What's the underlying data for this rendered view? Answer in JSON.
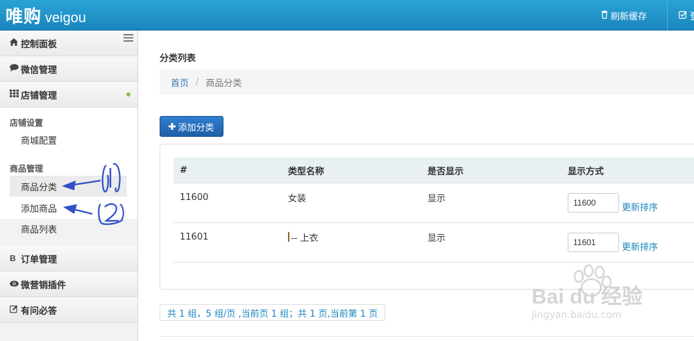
{
  "header": {
    "logo_cn": "唯购",
    "logo_en": "veigou",
    "refresh_label": "刷新缓存",
    "other_label": "登"
  },
  "sidebar": {
    "menus": [
      {
        "label": "控制面板",
        "icon": "home-icon"
      },
      {
        "label": "微信管理",
        "icon": "comment-icon"
      },
      {
        "label": "店铺管理",
        "icon": "grid-icon"
      },
      {
        "label": "订单管理",
        "icon": "bitcoin-icon"
      },
      {
        "label": "微营销插件",
        "icon": "eye-icon"
      },
      {
        "label": "有问必答",
        "icon": "edit-icon"
      }
    ],
    "sections": [
      {
        "title": "店铺设置",
        "items": [
          "商城配置"
        ]
      },
      {
        "title": "商品管理",
        "items": [
          "商品分类",
          "添加商品",
          "商品列表"
        ]
      }
    ],
    "active_item": "商品分类"
  },
  "main": {
    "page_title": "分类列表",
    "breadcrumb": {
      "home": "首页",
      "sep": "/",
      "current": "商品分类"
    },
    "add_button": "添加分类",
    "table": {
      "headers": [
        "#",
        "类型名称",
        "是否显示",
        "显示方式"
      ],
      "rows": [
        {
          "id": "11600",
          "name": "女装",
          "show": "显示",
          "sort": "11600",
          "action": "更新排序"
        },
        {
          "id": "11601",
          "name": "-- 上衣",
          "show": "显示",
          "sort": "11601",
          "action": "更新排序"
        }
      ]
    },
    "pager": "共 1 组，5 组/页 ,当前页 1 组；共 1 页,当前第 1 页"
  },
  "watermark": {
    "brand": "Bai du 经验",
    "url": "jingyan.baidu.com"
  },
  "colors": {
    "header": "#1a86bd",
    "button": "#2f7fd0",
    "link": "#337ab7",
    "annotation": "#3050c8"
  }
}
